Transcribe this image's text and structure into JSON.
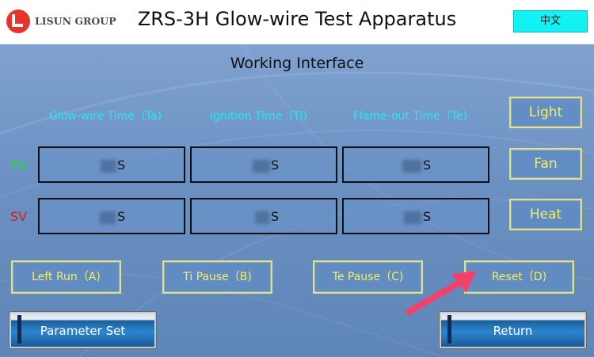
{
  "header": {
    "logo_text": "LISUN GROUP",
    "title": "ZRS-3H Glow-wire Test Apparatus",
    "lang_button": "中文"
  },
  "panel": {
    "sub_title": "Working Interface",
    "columns": [
      {
        "label": "Glow-wire Time（Ta)"
      },
      {
        "label": "Ignition Time（Ti)"
      },
      {
        "label": "Flame-out Time（Te)"
      }
    ],
    "rows": [
      {
        "label": "PV",
        "color": "#1fdc2a",
        "units": [
          "S",
          "S",
          "S"
        ]
      },
      {
        "label": "SV",
        "color": "#e01818",
        "units": [
          "S",
          "S",
          "S"
        ]
      }
    ],
    "side_buttons": [
      "Light",
      "Fan",
      "Heat"
    ],
    "action_buttons": [
      "Left Run（A)",
      "Ti Pause（B)",
      "Te Pause（C)",
      "Reset（D)"
    ],
    "bottom_buttons": {
      "parameter_set": "Parameter Set",
      "return": "Return"
    }
  },
  "colors": {
    "header_bg": "#ffffff",
    "panel_bg": "#6b90c2",
    "header_text": "#26e8ee",
    "button_text": "#f3ef62",
    "lang_button_bg": "#12f2f5",
    "annotation_arrow": "#f2426b"
  }
}
